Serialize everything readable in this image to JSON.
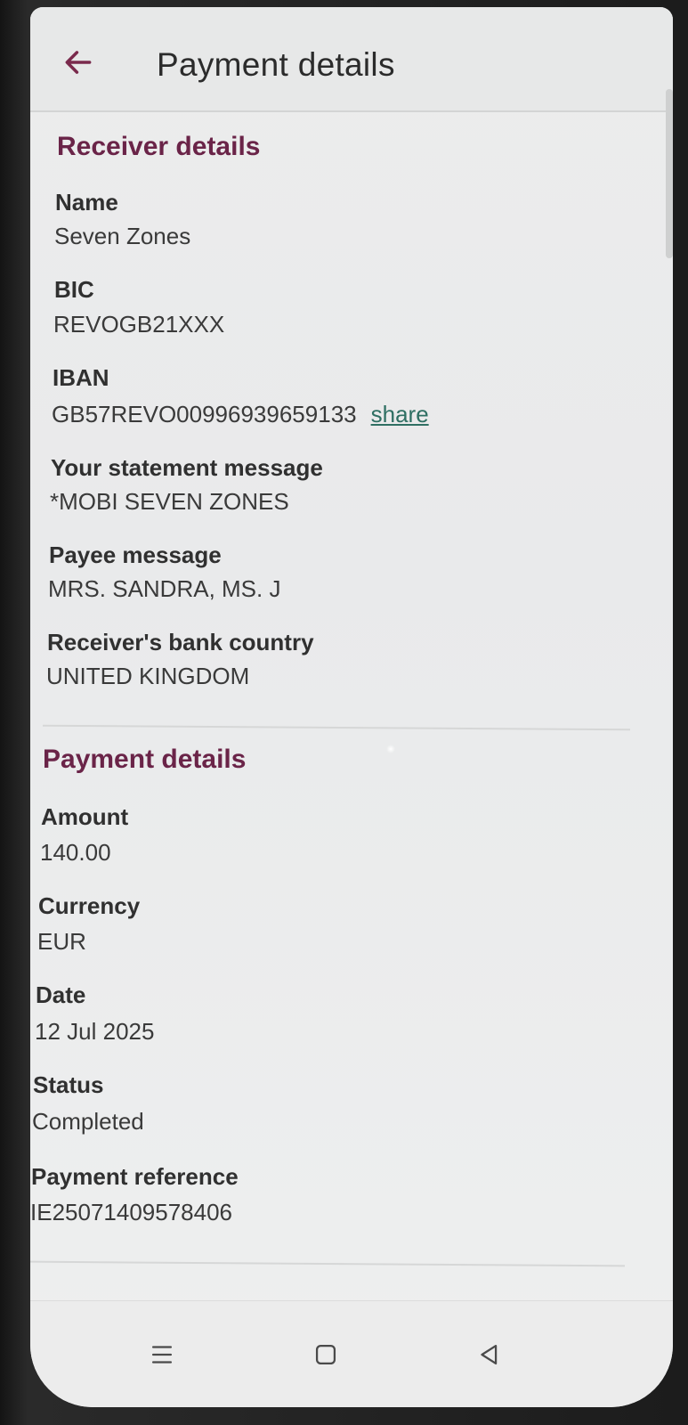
{
  "app_bar": {
    "title": "Payment details",
    "back_icon": "arrow-left-icon"
  },
  "receiver": {
    "section_title": "Receiver details",
    "name_label": "Name",
    "name_value": "Seven Zones",
    "bic_label": "BIC",
    "bic_value": "REVOGB21XXX",
    "iban_label": "IBAN",
    "iban_value": "GB57REVO00996939659133",
    "share_label": "share",
    "statement_label": "Your statement message",
    "statement_value": "*MOBI SEVEN ZONES",
    "payee_label": "Payee message",
    "payee_value": "MRS. SANDRA, MS. J",
    "country_label": "Receiver's bank country",
    "country_value": "UNITED KINGDOM"
  },
  "payment": {
    "section_title": "Payment details",
    "amount_label": "Amount",
    "amount_value": "140.00",
    "currency_label": "Currency",
    "currency_value": "EUR",
    "date_label": "Date",
    "date_value": "12 Jul 2025",
    "status_label": "Status",
    "status_value": "Completed",
    "reference_label": "Payment reference",
    "reference_value": "IE25071409578406"
  },
  "nav": {
    "recents_icon": "recents-icon",
    "home_icon": "home-icon",
    "back_icon": "triangle-back-icon"
  },
  "colors": {
    "accent": "#6a2448",
    "link": "#2f6f63",
    "back_arrow": "#7a2a4c"
  }
}
